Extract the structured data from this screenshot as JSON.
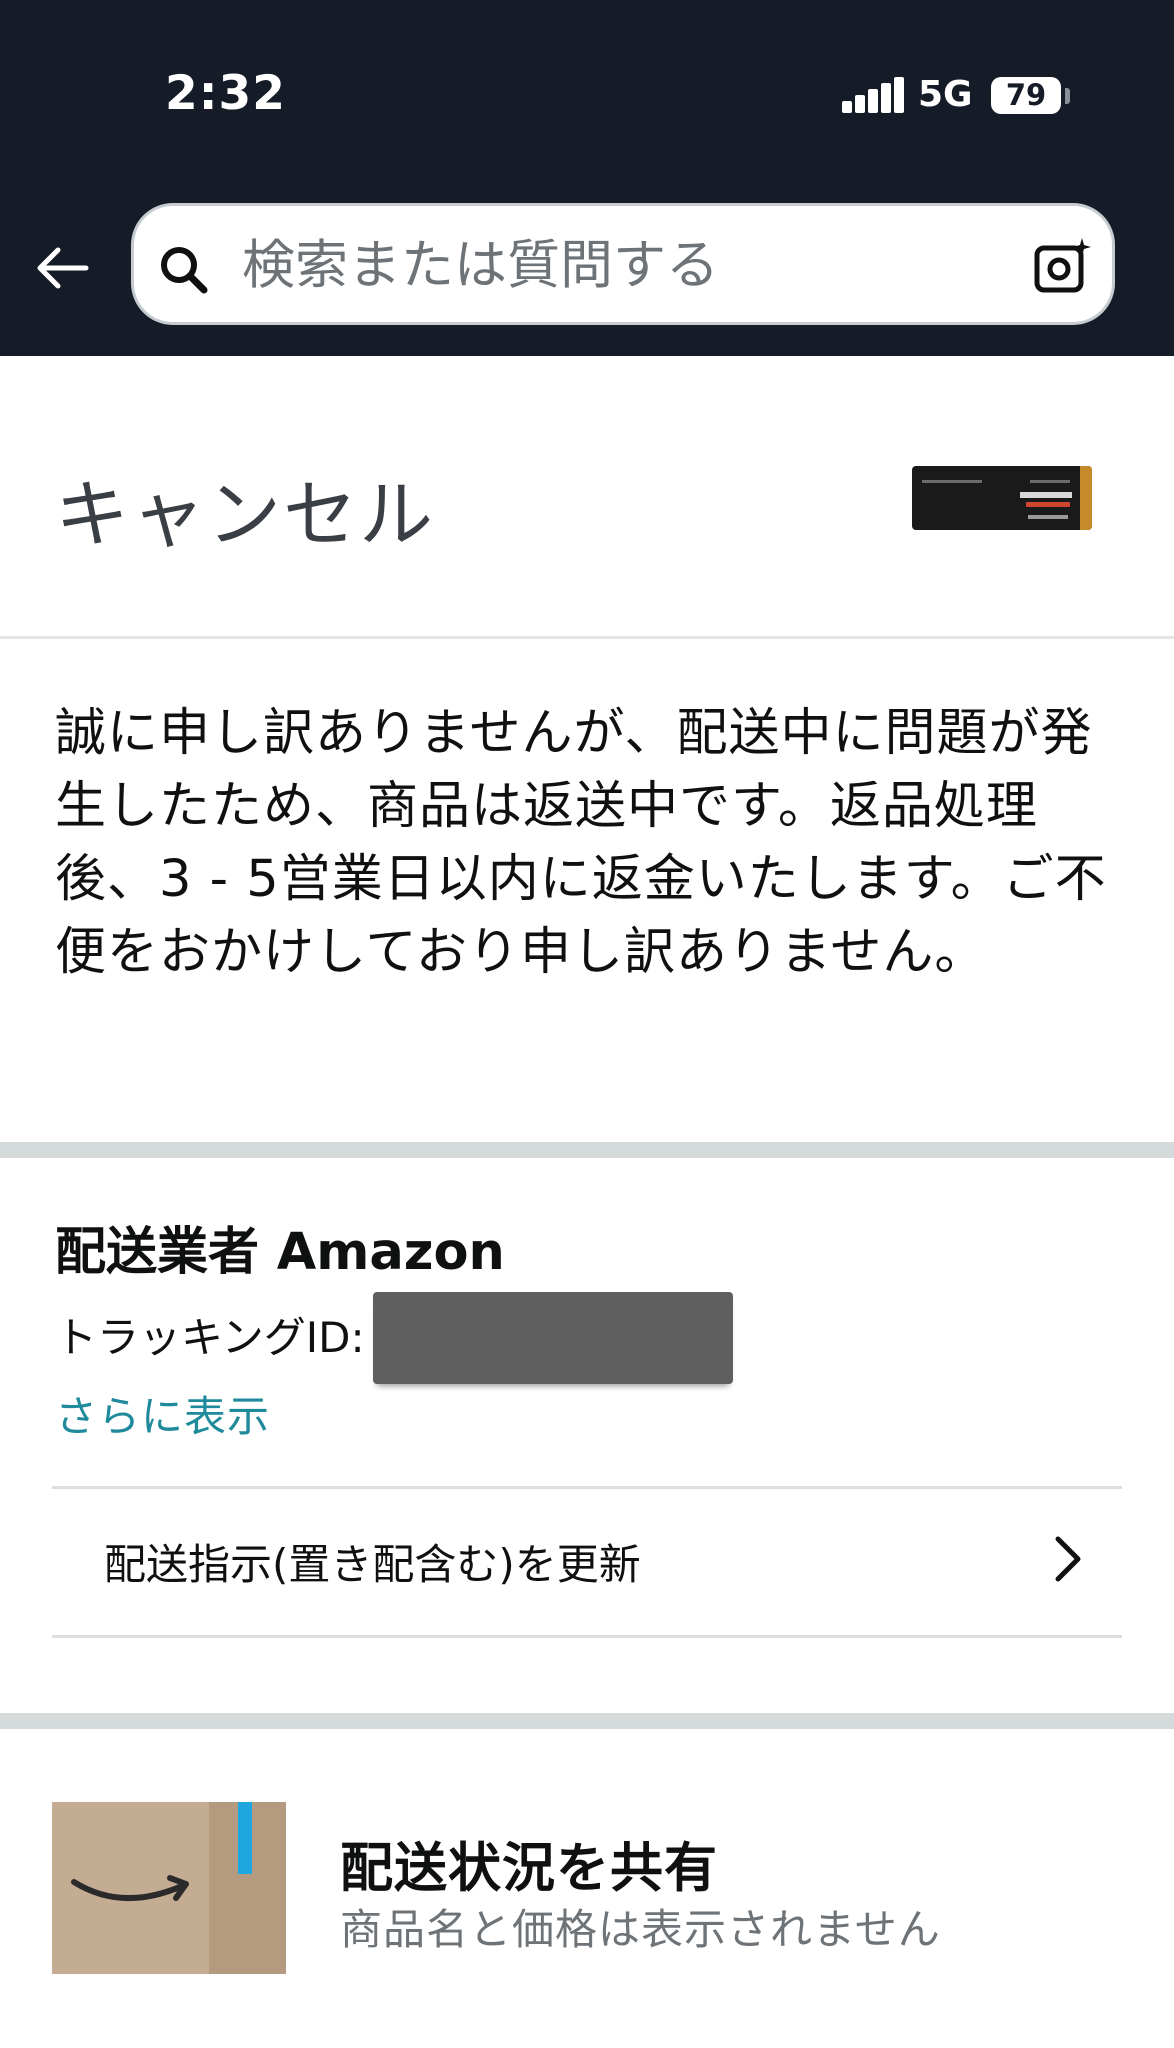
{
  "status_bar": {
    "time": "2:32",
    "network": "5G",
    "battery": "79"
  },
  "search": {
    "placeholder": "検索または質問する"
  },
  "order": {
    "status_title": "キャンセル",
    "message": "誠に申し訳ありませんが、配送中に問題が発生したため、商品は返送中です。返品処理後、3 - 5営業日以内に返金いたします。ご不便をおかけしており申し訳ありません。"
  },
  "shipping": {
    "carrier_label": "配送業者 Amazon",
    "tracking_label": "トラッキングID:",
    "more_link": "さらに表示",
    "update_instructions": "配送指示(置き配含む)を更新"
  },
  "share": {
    "title": "配送状況を共有",
    "subtitle": "商品名と価格は表示されません"
  },
  "colors": {
    "header_bg": "#151c28",
    "link": "#1f8a9b",
    "section_band": "#d5dbdb"
  },
  "icons": [
    "back-arrow-icon",
    "search-icon",
    "camera-icon",
    "chevron-right-icon",
    "signal-icon",
    "battery-icon"
  ]
}
